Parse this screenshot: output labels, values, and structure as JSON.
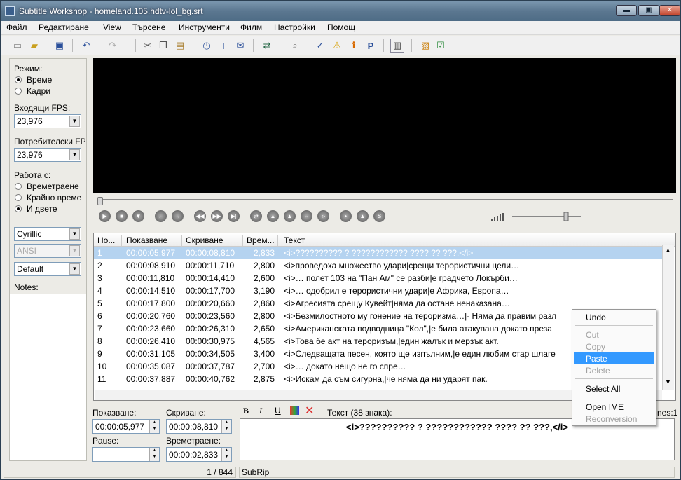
{
  "window": {
    "title": "Subtitle Workshop - homeland.105.hdtv-lol_bg.srt",
    "min": "▬",
    "max": "▣",
    "close": "✕"
  },
  "menu": [
    "Файл",
    "Редактиране",
    "View",
    "Търсене",
    "Инструменти",
    "Филм",
    "Настройки",
    "Помощ"
  ],
  "left": {
    "mode_label": "Режим:",
    "mode_time": "Време",
    "mode_frames": "Кадри",
    "input_fps_label": "Входящи FPS:",
    "input_fps": "23,976",
    "user_fps_label": "Потребителски FP",
    "user_fps": "23,976",
    "work_label": "Работа с:",
    "work_duration": "Времетраене",
    "work_final": "Крайно време",
    "work_both": "И двете",
    "charset": "Cyrillic",
    "encoding": "ANSI",
    "style": "Default",
    "notes_label": "Notes:"
  },
  "grid": {
    "headers": [
      "Но...",
      "Показване",
      "Скриване",
      "Врем...",
      "Текст"
    ],
    "rows": [
      {
        "n": "1",
        "show": "00:00:05,977",
        "hide": "00:00:08,810",
        "dur": "2,833",
        "text": "<i>?????????? ? ???????????? ???? ?? ???,</i>"
      },
      {
        "n": "2",
        "show": "00:00:08,910",
        "hide": "00:00:11,710",
        "dur": "2,800",
        "text": "<i>проведоха множество удари|срещи терористични цели…"
      },
      {
        "n": "3",
        "show": "00:00:11,810",
        "hide": "00:00:14,410",
        "dur": "2,600",
        "text": "<i>… полет 103 на \"Пан Ам\" се разби|е градчето Локърби…"
      },
      {
        "n": "4",
        "show": "00:00:14,510",
        "hide": "00:00:17,700",
        "dur": "3,190",
        "text": "<i>… одобрил е терористични удари|е Африка, Европа…"
      },
      {
        "n": "5",
        "show": "00:00:17,800",
        "hide": "00:00:20,660",
        "dur": "2,860",
        "text": "<i>Агресията срещу Кувейт|няма да остане ненаказана…"
      },
      {
        "n": "6",
        "show": "00:00:20,760",
        "hide": "00:00:23,560",
        "dur": "2,800",
        "text": "<i>Безмилостното му гонение на тероризма…|- Няма да правим разл"
      },
      {
        "n": "7",
        "show": "00:00:23,660",
        "hide": "00:00:26,310",
        "dur": "2,650",
        "text": "<i>Американската подводница \"Кол\",|е била атакувана докато преза"
      },
      {
        "n": "8",
        "show": "00:00:26,410",
        "hide": "00:00:30,975",
        "dur": "4,565",
        "text": "<i>Това бе акт на тероризъм,|един жалък и мерзък акт."
      },
      {
        "n": "9",
        "show": "00:00:31,105",
        "hide": "00:00:34,505",
        "dur": "3,400",
        "text": "<i>Следващата песен, която ще изпълним,|е един любим стар шлаге"
      },
      {
        "n": "10",
        "show": "00:00:35,087",
        "hide": "00:00:37,787",
        "dur": "2,700",
        "text": "<i>… докато нещо не го спре…"
      },
      {
        "n": "11",
        "show": "00:00:37,887",
        "hide": "00:00:40,762",
        "dur": "2,875",
        "text": "<i>Искам да съм сигурна,|че няма да ни ударят пак."
      }
    ]
  },
  "editor": {
    "show_label": "Показване:",
    "show": "00:00:05,977",
    "hide_label": "Скриване:",
    "hide": "00:00:08,810",
    "pause_label": "Pause:",
    "pause": "",
    "dur_label": "Времетраене:",
    "dur": "00:00:02,833",
    "text_label": "Текст (38 знака):",
    "lines_label": "nes:1",
    "text": "<i>?????????? ? ???????????? ???? ?? ???,</i>"
  },
  "status": {
    "position": "1 / 844",
    "format": "SubRip"
  },
  "context_menu": {
    "undo": "Undo",
    "cut": "Cut",
    "copy": "Copy",
    "paste": "Paste",
    "delete": "Delete",
    "select_all": "Select All",
    "open_ime": "Open IME",
    "reconversion": "Reconversion"
  },
  "colors": {
    "selection": "#3399ff",
    "row_selected": "#b5d3f0",
    "video": "#000000"
  }
}
